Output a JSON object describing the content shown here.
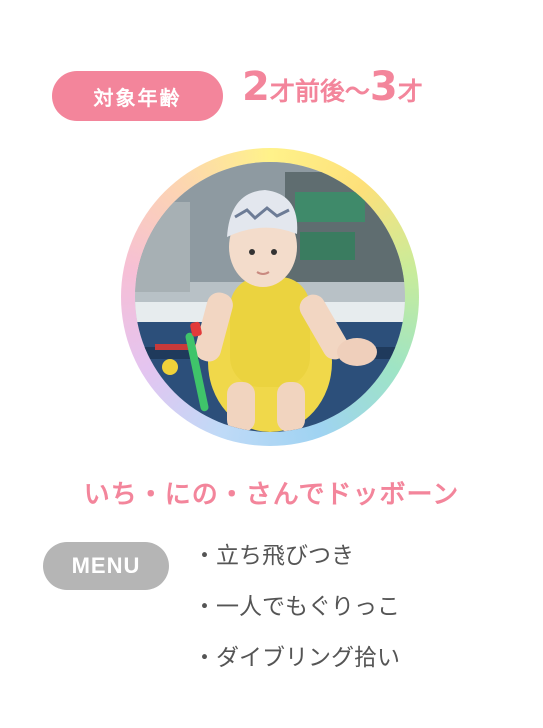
{
  "age": {
    "badge_label": "対象年齢",
    "from_number": "2",
    "from_unit": "才前後",
    "separator": "〜",
    "to_number": "3",
    "to_unit": "才"
  },
  "photo": {
    "alt_subject": "child-in-yellow-swimsuit-at-pool"
  },
  "program_title": "いち・にの・さんでドッボーン",
  "menu": {
    "badge_label": "MENU",
    "items": [
      "立ち飛びつき",
      "一人でもぐりっこ",
      "ダイブリング拾い"
    ]
  },
  "colors": {
    "accent_pink": "#f3859b",
    "menu_gray": "#b5b5b5",
    "text_gray": "#555555"
  }
}
